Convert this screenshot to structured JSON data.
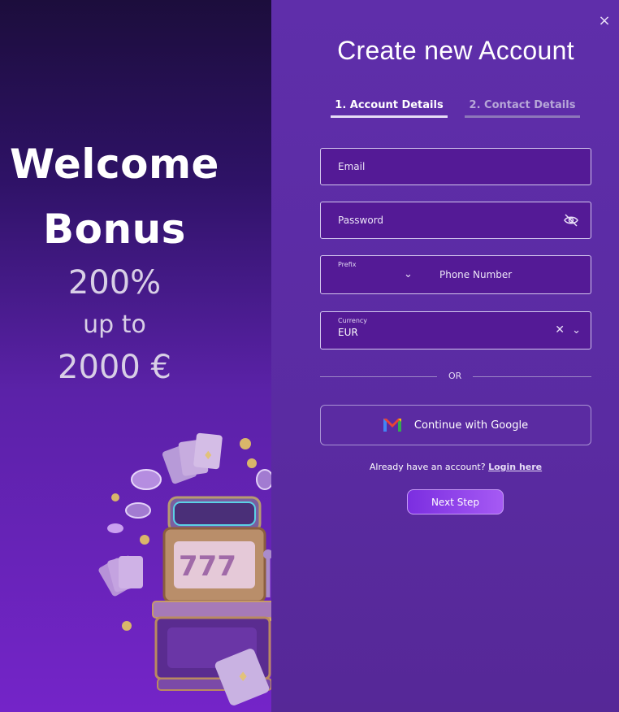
{
  "promo": {
    "line1": "Welcome",
    "line2": "Bonus",
    "percent": "200%",
    "upto": "up to",
    "amount": "2000 €"
  },
  "modal": {
    "close_label": "×",
    "title": "Create new Account",
    "tabs": [
      {
        "label": "1. Account Details",
        "active": true
      },
      {
        "label": "2. Contact Details",
        "active": false
      }
    ],
    "email": {
      "placeholder": "Email"
    },
    "password": {
      "placeholder": "Password"
    },
    "phone": {
      "prefix_label": "Prefix",
      "placeholder": "Phone Number"
    },
    "currency": {
      "label": "Currency",
      "value": "EUR"
    },
    "or_label": "OR",
    "google_button": "Continue with Google",
    "login_prompt": "Already have an account?",
    "login_link": "Login here",
    "next_button": "Next Step"
  },
  "colors": {
    "accent": "#9b4ff0",
    "panel_bg": "#5a2ba2",
    "field_bg": "#541a96"
  }
}
